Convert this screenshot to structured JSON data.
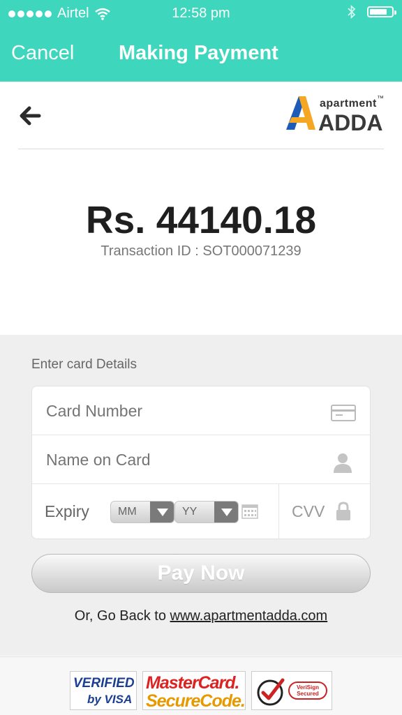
{
  "status_bar": {
    "carrier": "Airtel",
    "time": "12:58 pm",
    "battery_level": 0.8
  },
  "header": {
    "cancel_label": "Cancel",
    "title": "Making Payment"
  },
  "logo": {
    "small": "apartment",
    "big": "ADDA",
    "tm": "™"
  },
  "payment": {
    "amount": "Rs. 44140.18",
    "transaction": "Transaction ID : SOT000071239"
  },
  "card_form": {
    "section_label": "Enter card Details",
    "card_number_placeholder": "Card Number",
    "name_placeholder": "Name on Card",
    "expiry_label": "Expiry",
    "month_value": "MM",
    "year_value": "YY",
    "cvv_placeholder": "CVV"
  },
  "pay_button": "Pay Now",
  "go_back": {
    "prefix": "Or, Go Back to ",
    "link": "www.apartmentadda.com"
  },
  "badges": {
    "visa_line1": "VERIFIED",
    "visa_line2": "by VISA",
    "mc_line1": "MasterCard.",
    "mc_line2": "SecureCode.",
    "verisign_line1": "VeriSign",
    "verisign_line2": "Secured"
  },
  "colors": {
    "accent": "#3ed6bc",
    "logo_blue": "#1e5bb8",
    "logo_orange": "#f5a623"
  }
}
